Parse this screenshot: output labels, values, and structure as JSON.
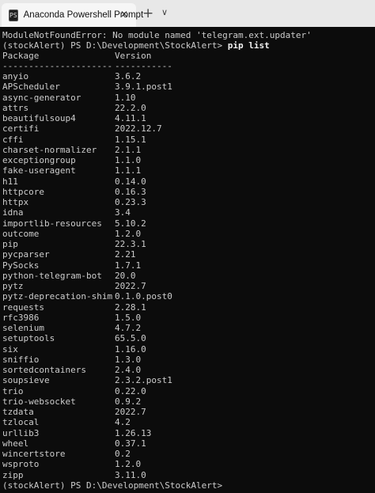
{
  "window": {
    "tab_title": "Anaconda Powershell Prompt",
    "tab_icon": "PS",
    "close_glyph": "✕",
    "new_tab_glyph": "+",
    "dropdown_glyph": "∨"
  },
  "terminal": {
    "error_line": "ModuleNotFoundError: No module named 'telegram.ext.updater'",
    "prompt": "(stockAlert) PS D:\\Development\\StockAlert> ",
    "command": "pip list",
    "header": {
      "package": "Package",
      "version": "Version"
    },
    "separator": {
      "package": "---------------------",
      "version": "-----------"
    },
    "packages": [
      {
        "name": "anyio",
        "version": "3.6.2"
      },
      {
        "name": "APScheduler",
        "version": "3.9.1.post1"
      },
      {
        "name": "async-generator",
        "version": "1.10"
      },
      {
        "name": "attrs",
        "version": "22.2.0"
      },
      {
        "name": "beautifulsoup4",
        "version": "4.11.1"
      },
      {
        "name": "certifi",
        "version": "2022.12.7"
      },
      {
        "name": "cffi",
        "version": "1.15.1"
      },
      {
        "name": "charset-normalizer",
        "version": "2.1.1"
      },
      {
        "name": "exceptiongroup",
        "version": "1.1.0"
      },
      {
        "name": "fake-useragent",
        "version": "1.1.1"
      },
      {
        "name": "h11",
        "version": "0.14.0"
      },
      {
        "name": "httpcore",
        "version": "0.16.3"
      },
      {
        "name": "httpx",
        "version": "0.23.3"
      },
      {
        "name": "idna",
        "version": "3.4"
      },
      {
        "name": "importlib-resources",
        "version": "5.10.2"
      },
      {
        "name": "outcome",
        "version": "1.2.0"
      },
      {
        "name": "pip",
        "version": "22.3.1"
      },
      {
        "name": "pycparser",
        "version": "2.21"
      },
      {
        "name": "PySocks",
        "version": "1.7.1"
      },
      {
        "name": "python-telegram-bot",
        "version": "20.0"
      },
      {
        "name": "pytz",
        "version": "2022.7"
      },
      {
        "name": "pytz-deprecation-shim",
        "version": "0.1.0.post0"
      },
      {
        "name": "requests",
        "version": "2.28.1"
      },
      {
        "name": "rfc3986",
        "version": "1.5.0"
      },
      {
        "name": "selenium",
        "version": "4.7.2"
      },
      {
        "name": "setuptools",
        "version": "65.5.0"
      },
      {
        "name": "six",
        "version": "1.16.0"
      },
      {
        "name": "sniffio",
        "version": "1.3.0"
      },
      {
        "name": "sortedcontainers",
        "version": "2.4.0"
      },
      {
        "name": "soupsieve",
        "version": "2.3.2.post1"
      },
      {
        "name": "trio",
        "version": "0.22.0"
      },
      {
        "name": "trio-websocket",
        "version": "0.9.2"
      },
      {
        "name": "tzdata",
        "version": "2022.7"
      },
      {
        "name": "tzlocal",
        "version": "4.2"
      },
      {
        "name": "urllib3",
        "version": "1.26.13"
      },
      {
        "name": "wheel",
        "version": "0.37.1"
      },
      {
        "name": "wincertstore",
        "version": "0.2"
      },
      {
        "name": "wsproto",
        "version": "1.2.0"
      },
      {
        "name": "zipp",
        "version": "3.11.0"
      }
    ],
    "final_prompt": "(stockAlert) PS D:\\Development\\StockAlert>"
  }
}
